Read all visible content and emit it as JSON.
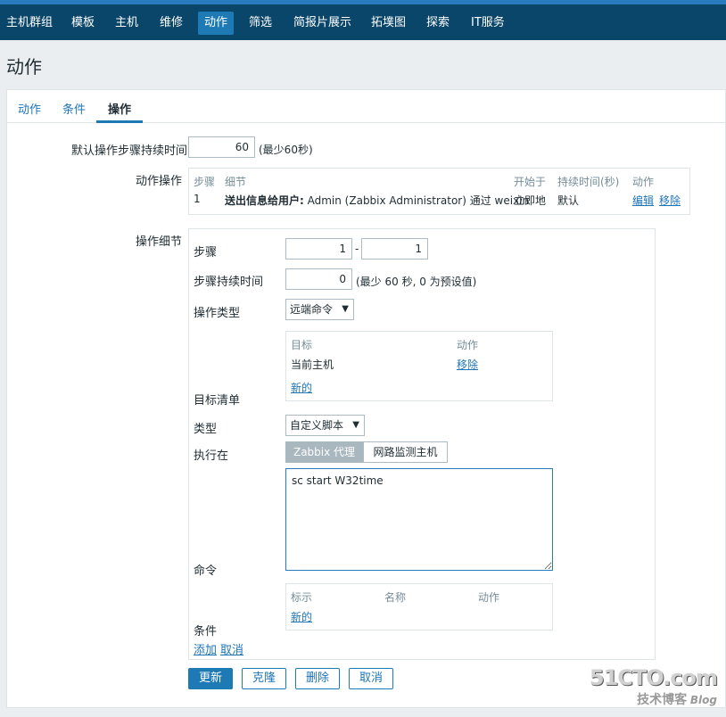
{
  "nav": {
    "items": [
      "主机群组",
      "模板",
      "主机",
      "维修",
      "动作",
      "筛选",
      "简报片展示",
      "拓墣图",
      "探索",
      "IT服务"
    ],
    "active_index": 4
  },
  "page": {
    "title": "动作"
  },
  "tabs": [
    "动作",
    "条件",
    "操作"
  ],
  "active_tab": "操作",
  "form": {
    "default_step_duration_label": "默认操作步骤持续时间",
    "default_step_duration_value": "60",
    "default_step_duration_hint": "(最少60秒)",
    "action_ops_label": "动作操作",
    "ops_table": {
      "headers": [
        "步骤",
        "细节",
        "开始于",
        "持续时间(秒)",
        "动作"
      ],
      "rows": [
        {
          "step": "1",
          "detail_bold": "送出信息给用户:",
          "detail_rest": " Admin (Zabbix Administrator) 通过 weixin",
          "start": "立即地",
          "duration": "默认",
          "edit": "编辑",
          "remove": "移除"
        }
      ]
    },
    "op_detail_label": "操作细节",
    "step_label": "步骤",
    "step_from": "1",
    "step_sep": "-",
    "step_to": "1",
    "step_duration_label": "步骤持续时间",
    "step_duration_value": "0",
    "step_duration_hint": "(最少 60 秒, 0 为预设值)",
    "op_type_label": "操作类型",
    "op_type_value": "远端命令",
    "target_table": {
      "headers": [
        "目标",
        "动作"
      ],
      "row_target": "当前主机",
      "row_action": "移除",
      "new_link": "新的"
    },
    "target_list_label": "目标清单",
    "type_label": "类型",
    "type_value": "自定义脚本",
    "execute_on_label": "执行在",
    "execute_options": [
      "Zabbix 代理",
      "网路监测主机"
    ],
    "execute_selected": "Zabbix 代理",
    "command_label": "命令",
    "command_value": "sc start W32time",
    "conditions_table": {
      "headers": [
        "标示",
        "名称",
        "动作"
      ],
      "new_link": "新的"
    },
    "conditions_label": "条件",
    "add_link": "添加",
    "cancel_link": "取消"
  },
  "buttons": {
    "update": "更新",
    "clone": "克隆",
    "delete": "删除",
    "cancel": "取消"
  },
  "watermark": {
    "logo": "51CTO.com",
    "sub": "技术博客",
    "blog": "Blog"
  },
  "colors": {
    "nav_bg": "#0a466a",
    "accent": "#1e7ab5",
    "link": "#1f74b8"
  }
}
